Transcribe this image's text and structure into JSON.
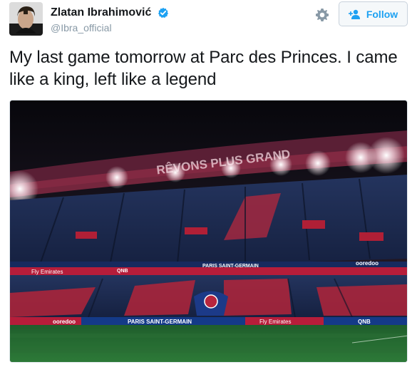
{
  "user": {
    "display_name": "Zlatan Ibrahimović",
    "handle": "@Ibra_official",
    "verified": true
  },
  "actions": {
    "follow_label": "Follow"
  },
  "tweet": {
    "text": "My last game tomorrow at Parc des Princes. I came like a king, left like a legend"
  },
  "photo": {
    "roof_banner": "RÊVONS PLUS GRAND",
    "sponsor_fly_emirates": "Fly Emirates",
    "sponsor_qnb": "QNB",
    "sponsor_ooredoo": "ooredoo",
    "club_name": "PARIS SAINT-GERMAIN"
  },
  "colors": {
    "link_blue": "#1da1f2",
    "verified_blue": "#1da1f2",
    "text": "#14171a",
    "muted": "#8899a6"
  },
  "icons": [
    "avatar",
    "verified-badge-icon",
    "gear-icon",
    "follow-person-plus-icon"
  ]
}
